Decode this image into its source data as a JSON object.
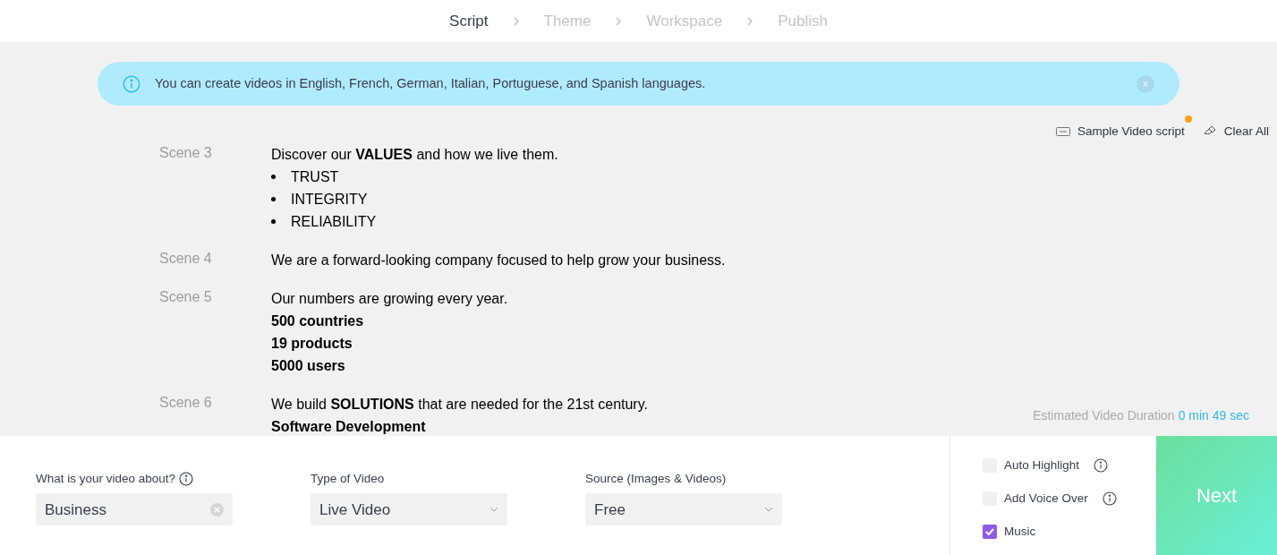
{
  "steps": [
    {
      "label": "Script",
      "selected": true
    },
    {
      "label": "Theme",
      "selected": false
    },
    {
      "label": "Workspace",
      "selected": false
    },
    {
      "label": "Publish",
      "selected": false
    }
  ],
  "banner": {
    "text": "You can create videos in English, French, German, Italian, Portuguese, and Spanish languages.",
    "close": "x"
  },
  "tools": {
    "sample": "Sample Video script",
    "sample_badge": true,
    "clear": "Clear All"
  },
  "scenes": [
    {
      "label": "Scene 3",
      "lines": [
        {
          "kind": "text",
          "text": "Discover our **VALUES** and how we live them."
        },
        {
          "kind": "bullet",
          "text": "TRUST"
        },
        {
          "kind": "bullet",
          "text": "INTEGRITY"
        },
        {
          "kind": "bullet",
          "text": "RELIABILITY"
        }
      ]
    },
    {
      "label": "Scene 4",
      "lines": [
        {
          "kind": "text",
          "text": "We are a forward-looking company focused to help grow your business."
        }
      ]
    },
    {
      "label": "Scene 5",
      "lines": [
        {
          "kind": "text",
          "text": "Our numbers are growing every year."
        },
        {
          "kind": "bold",
          "text": "500 countries"
        },
        {
          "kind": "bold",
          "text": "19 products"
        },
        {
          "kind": "bold",
          "text": "5000 users"
        }
      ]
    },
    {
      "label": "Scene 6",
      "lines": [
        {
          "kind": "text",
          "text": "We build **SOLUTIONS** that are needed for the 21st century."
        },
        {
          "kind": "bold",
          "text": "Software Development"
        }
      ]
    }
  ],
  "duration": {
    "label": "Estimated Video Duration",
    "value": "0 min 49 sec"
  },
  "fields": [
    {
      "kind": "input",
      "label": "What is your video about?",
      "info": true,
      "value": "Business"
    },
    {
      "kind": "select",
      "label": "Type of Video",
      "info": false,
      "value": "Live Video"
    },
    {
      "kind": "select",
      "label": "Source (Images & Videos)",
      "info": false,
      "value": "Free"
    }
  ],
  "options": [
    {
      "label": "Auto Highlight",
      "checked": false,
      "info": true
    },
    {
      "label": "Add Voice Over",
      "checked": false,
      "info": true
    },
    {
      "label": "Music",
      "checked": true,
      "info": false
    }
  ],
  "next": "Next"
}
